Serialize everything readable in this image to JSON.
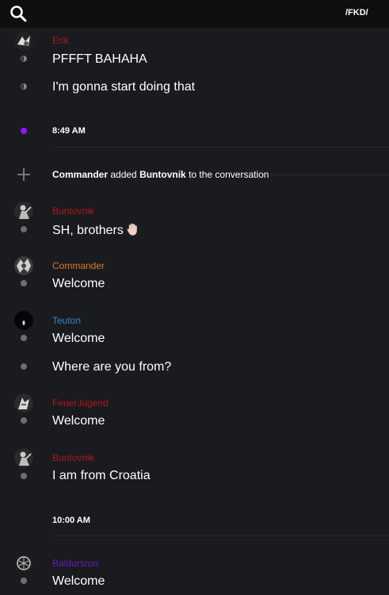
{
  "header": {
    "channel": "/FKD/",
    "search_icon": "search-icon"
  },
  "colors": {
    "red_user": "#b01818",
    "orange_user": "#d97a25",
    "blue_user": "#2f86c9",
    "purple_user": "#6a1ab5",
    "unread_dot": "#8e16ff"
  },
  "messages": [
    {
      "user": "Erik",
      "text": "PFFFT BAHAHA"
    },
    {
      "text": "I'm gonna start doing that"
    },
    {
      "time": "8:49 AM"
    },
    {
      "system_actor": "Commander",
      "system_mid": " added ",
      "system_target": "Buntovnik",
      "system_tail": " to the conversation"
    },
    {
      "user": "Buntovnik",
      "text": "SH, brothers",
      "emoji": "raised-hand-icon"
    },
    {
      "user": "Commander",
      "text": "Welcome"
    },
    {
      "user": "Teuton",
      "text": "Welcome"
    },
    {
      "text": "Where are you from?"
    },
    {
      "user": "FeuerJugend",
      "text": "Welcome"
    },
    {
      "user": "Buntovnik",
      "text": "I am from Croatia"
    },
    {
      "time": "10:00 AM"
    },
    {
      "user": "Baldursrun",
      "text": "Welcome"
    }
  ]
}
